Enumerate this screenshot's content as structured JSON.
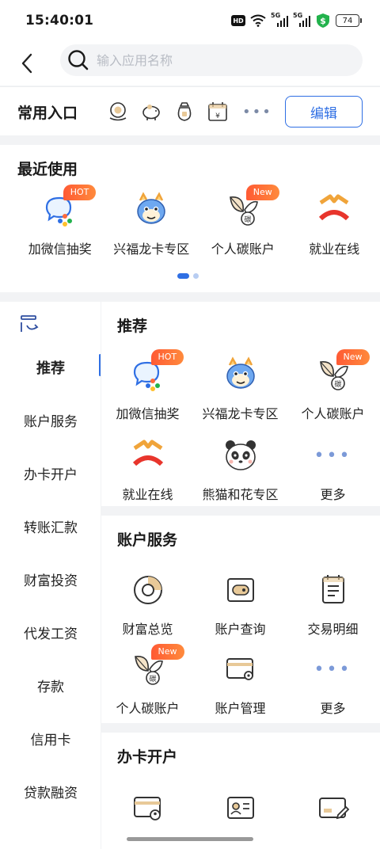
{
  "status": {
    "time": "15:40:01",
    "hd": "HD",
    "sim1": "5G",
    "sim2": "5G",
    "battery": "74"
  },
  "search": {
    "placeholder": "输入应用名称"
  },
  "quick_entry": {
    "title": "常用入口",
    "more": "•••",
    "edit_label": "编辑"
  },
  "recent": {
    "title": "最近使用",
    "items": [
      {
        "label": "加微信抽奖",
        "tag": "HOT"
      },
      {
        "label": "兴福龙卡专区"
      },
      {
        "label": "个人碳账户",
        "tag": "New"
      },
      {
        "label": "就业在线"
      }
    ]
  },
  "sidebar": {
    "items": [
      "推荐",
      "账户服务",
      "办卡开户",
      "转账汇款",
      "财富投资",
      "代发工资",
      "存款",
      "信用卡",
      "贷款融资"
    ]
  },
  "sections": {
    "recommend": {
      "title": "推荐",
      "items": [
        {
          "label": "加微信抽奖",
          "tag": "HOT"
        },
        {
          "label": "兴福龙卡专区"
        },
        {
          "label": "个人碳账户",
          "tag": "New"
        },
        {
          "label": "就业在线"
        },
        {
          "label": "熊猫和花专区"
        },
        {
          "label": "更多"
        }
      ]
    },
    "account": {
      "title": "账户服务",
      "items": [
        {
          "label": "财富总览"
        },
        {
          "label": "账户查询"
        },
        {
          "label": "交易明细"
        },
        {
          "label": "个人碳账户",
          "tag": "New"
        },
        {
          "label": "账户管理"
        },
        {
          "label": "更多"
        }
      ]
    },
    "card": {
      "title": "办卡开户"
    }
  },
  "colors": {
    "accent": "#2f6fe4",
    "hot": "#ff6a3a",
    "gold": "#c9a36a"
  }
}
